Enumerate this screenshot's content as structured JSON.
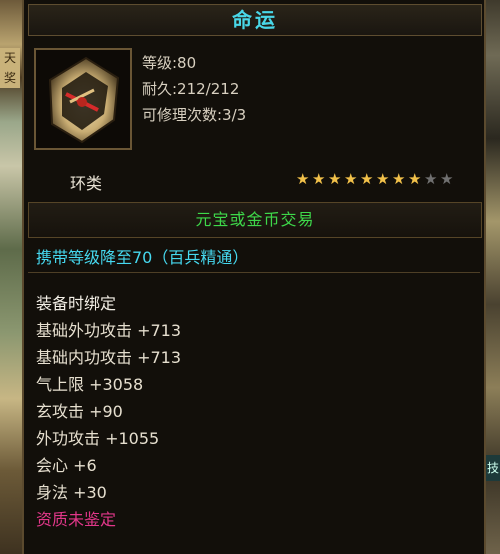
{
  "item": {
    "name": "命运",
    "level": "等级:80",
    "durability": "耐久:212/212",
    "repair": "可修理次数:3/3",
    "type": "环类",
    "stars_total": 10,
    "stars_filled": 8,
    "trade": "元宝或金币交易",
    "requirement": "携带等级降至70（百兵精通）",
    "bind": "装备时绑定",
    "attributes": [
      "基础外功攻击 +713",
      "基础内功攻击 +713",
      "气上限 +3058",
      "玄攻击 +90",
      "外功攻击 +1055",
      "会心 +6",
      "身法 +30"
    ],
    "quality": "资质未鉴定"
  },
  "background": {
    "left_tag": "天奖",
    "right_tag": "技"
  },
  "colors": {
    "title": "#49d7e8",
    "trade": "#3ed84a",
    "requirement": "#46d8ef",
    "quality": "#e2378a",
    "star_on": "#f2c14a",
    "star_off": "#707070"
  },
  "icon": "ring-weapon-icon"
}
